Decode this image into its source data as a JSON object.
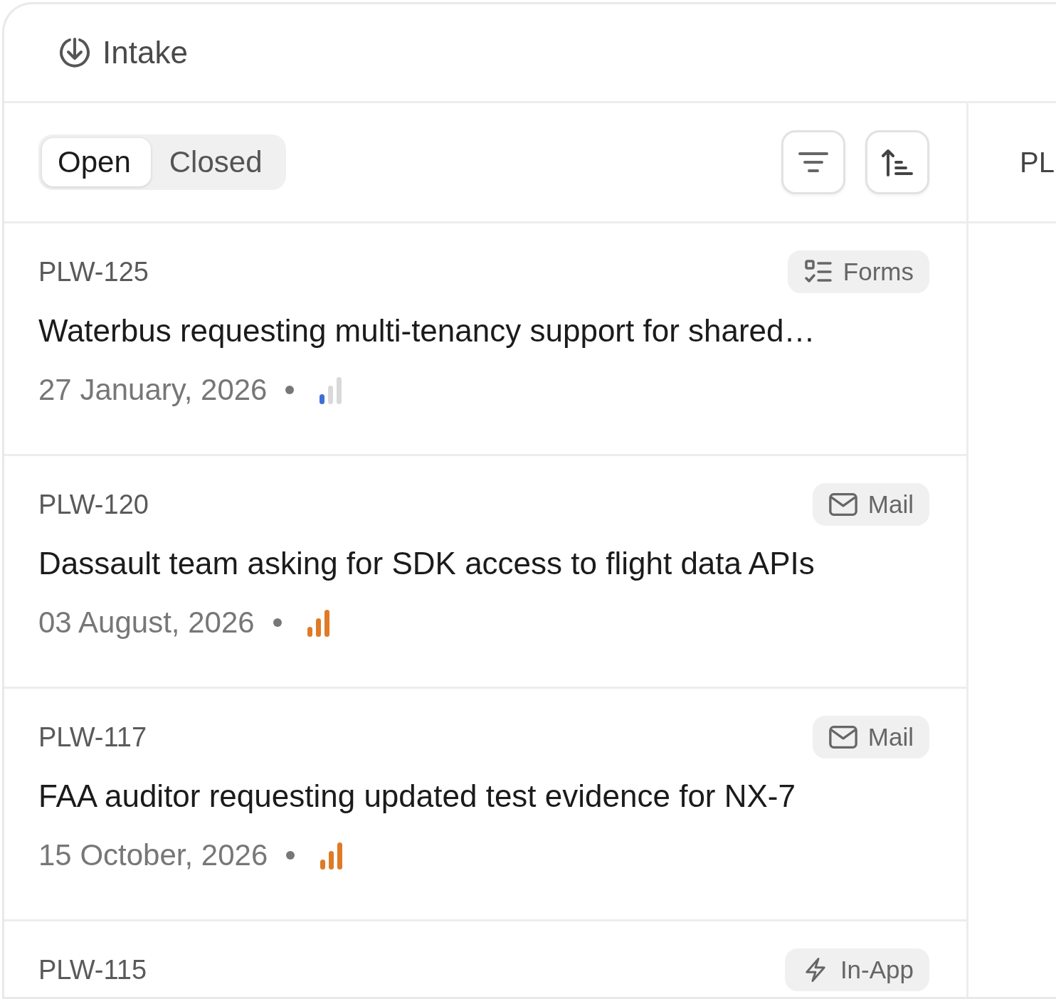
{
  "header": {
    "title": "Intake"
  },
  "filter_tabs": [
    {
      "label": "Open",
      "selected": true
    },
    {
      "label": "Closed",
      "selected": false
    }
  ],
  "requests": [
    {
      "id": "PLW-125",
      "source": {
        "kind": "forms",
        "label": "Forms"
      },
      "title": "Waterbus requesting multi-tenancy support for shared…",
      "date": "27 January, 2026",
      "high_priority": false
    },
    {
      "id": "PLW-120",
      "source": {
        "kind": "mail",
        "label": "Mail"
      },
      "title": "Dassault team asking for SDK access to flight data APIs",
      "date": "03 August, 2026",
      "high_priority": true
    },
    {
      "id": "PLW-117",
      "source": {
        "kind": "mail",
        "label": "Mail"
      },
      "title": "FAA auditor requesting updated test evidence for NX-7",
      "date": "15 October, 2026",
      "high_priority": true
    },
    {
      "id": "PLW-115",
      "source": {
        "kind": "in-app",
        "label": "In-App"
      }
    }
  ],
  "detail_panel": {
    "heading": "PL"
  }
}
